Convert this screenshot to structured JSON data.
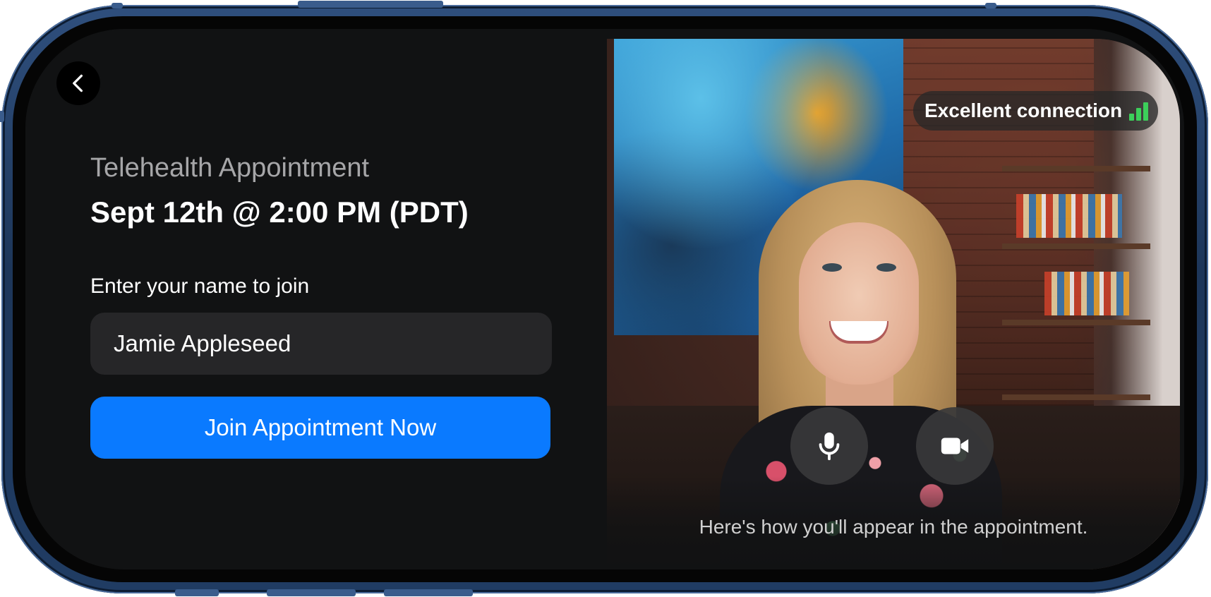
{
  "header": {
    "back_icon": "chevron-left-icon"
  },
  "appointment": {
    "kicker": "Telehealth Appointment",
    "time": "Sept 12th @ 2:00 PM (PDT)"
  },
  "join_form": {
    "label": "Enter your name to join",
    "name_value": "Jamie Appleseed",
    "join_button_label": "Join Appointment Now"
  },
  "preview": {
    "connection_status": "Excellent connection",
    "signal_icon": "signal-bars-icon",
    "mic_icon": "microphone-icon",
    "camera_icon": "video-camera-icon",
    "caption": "Here's how you'll appear in the appointment."
  },
  "colors": {
    "accent": "#0a7aff",
    "background": "#111213",
    "signal": "#3ccf5a",
    "input_bg": "#262628"
  }
}
